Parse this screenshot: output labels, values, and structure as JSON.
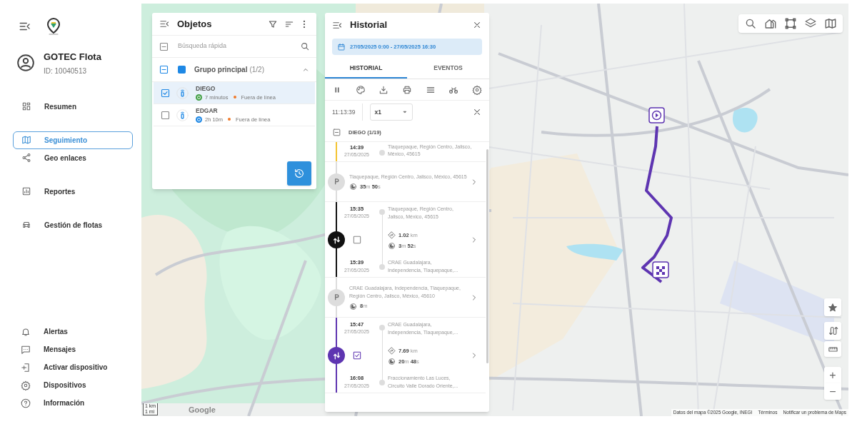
{
  "sidebar": {
    "account": {
      "name": "GOTEC Flota",
      "id": "ID: 10040513"
    },
    "nav_items": [
      {
        "label": "Resumen",
        "selected": false
      },
      {
        "label": "Seguimiento",
        "selected": true
      },
      {
        "label": "Geo enlaces",
        "selected": false
      },
      {
        "label": "Reportes",
        "selected": false
      },
      {
        "label": "Gestión de flotas",
        "selected": false
      }
    ],
    "bottom_items": [
      {
        "label": "Alertas"
      },
      {
        "label": "Mensajes"
      },
      {
        "label": "Activar dispositivo"
      },
      {
        "label": "Dispositivos"
      },
      {
        "label": "Información"
      }
    ]
  },
  "objects_panel": {
    "title": "Objetos",
    "search": {
      "placeholder": "Búsqueda rápida"
    },
    "group": {
      "name": "Grupo principal",
      "count": "(1/2)",
      "indeterminate": true,
      "expanded": true,
      "color": "#1e88e5"
    },
    "items": [
      {
        "name": "DIEGO",
        "checked": true,
        "selected": true,
        "duration": "7 minutos",
        "color": "#43a047",
        "status": "Fuera de línea"
      },
      {
        "name": "EDGAR",
        "checked": false,
        "selected": false,
        "duration": "2h 10m",
        "color": "#1e88e5",
        "status": "Fuera de línea"
      }
    ]
  },
  "history_panel": {
    "title": "Historial",
    "date_range": "27/05/2025 0:00 - 27/05/2025 16:30",
    "tabs": [
      {
        "label": "HISTORIAL",
        "selected": true
      },
      {
        "label": "EVENTOS",
        "selected": false
      }
    ],
    "playback": {
      "time": "11:13:39",
      "speed": "x1"
    },
    "device": {
      "label": "DIEGO (1/19)"
    },
    "entries": [
      {
        "kind": "trip_end",
        "color": "#f4c430",
        "time": "14:39",
        "date": "27/05/2025",
        "address": "Tlaquepaque, Región Centro, Jalisco, México, 45615"
      },
      {
        "kind": "stop",
        "address": "Tlaquepaque, Región Centro, Jalisco, México, 45615",
        "duration": "**35**m **50**s"
      },
      {
        "kind": "trip",
        "color": "#111111",
        "checked": false,
        "start_time": "15:35",
        "start_date": "27/05/2025",
        "start_address": "Tlaquepaque, Región Centro, Jalisco, México, 45615",
        "distance": "**1.02** km",
        "duration": "**3**m **52**s",
        "end_time": "15:39",
        "end_date": "27/05/2025",
        "end_address": "CRAE Guadalajara, Independencia, Tlaquepaque,..."
      },
      {
        "kind": "stop",
        "address": "CRAE Guadalajara, Independencia, Tlaquepaque, Región Centro, Jalisco, México, 45610",
        "duration": "**8**m"
      },
      {
        "kind": "trip",
        "color": "#5e35b1",
        "checked": true,
        "start_time": "15:47",
        "start_date": "27/05/2025",
        "start_address": "CRAE Guadalajara, Independencia, Tlaquepaque,...",
        "distance": "**7.69** km",
        "duration": "**20**m **48**s",
        "end_time": "16:08",
        "end_date": "27/05/2025",
        "end_address": "Fraccionamiento Las Luces, Circuito Valle Dorado Oriente,..."
      }
    ]
  },
  "map": {
    "zoom_in": "+",
    "zoom_out": "−",
    "scale": [
      "1 km",
      "1 mi"
    ],
    "logo": "Google",
    "attribution": [
      "Datos del mapa ©2025 Google, INEGI",
      "Términos",
      "Notificar un problema de Maps"
    ]
  }
}
